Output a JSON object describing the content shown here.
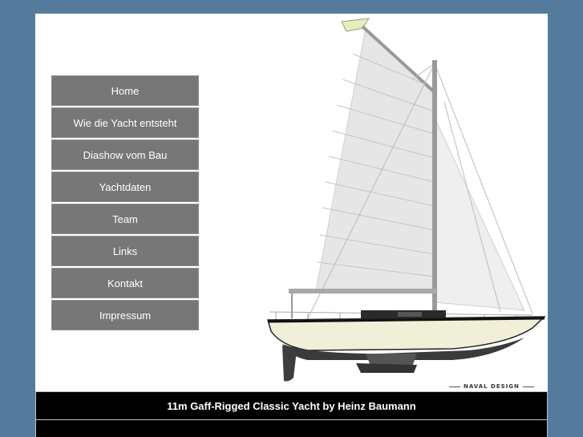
{
  "nav": {
    "items": [
      {
        "label": "Home"
      },
      {
        "label": "Wie die Yacht entsteht"
      },
      {
        "label": "Diashow vom Bau"
      },
      {
        "label": "Yachtdaten"
      },
      {
        "label": "Team"
      },
      {
        "label": "Links"
      },
      {
        "label": "Kontakt"
      },
      {
        "label": "Impressum"
      }
    ]
  },
  "drawing": {
    "signature": "NAVAL DESIGN"
  },
  "footer": {
    "title": "11m Gaff-Rigged Classic Yacht by Heinz Baumann"
  },
  "colors": {
    "background": "#557b9c",
    "nav_button": "#777777",
    "footer": "#000000",
    "hull": "#f2efd8"
  }
}
